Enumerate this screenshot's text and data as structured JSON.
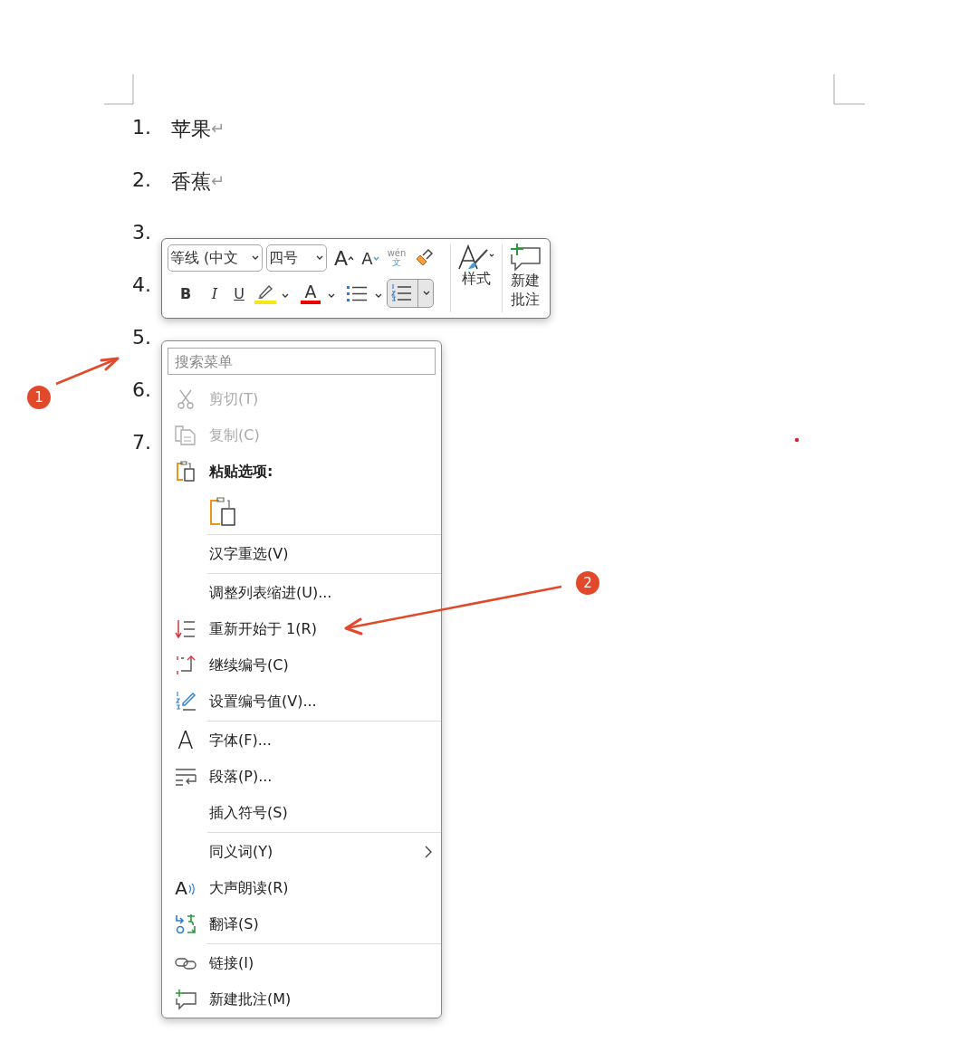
{
  "document": {
    "list": [
      {
        "number": "1.",
        "text": "苹果",
        "mark": "↵"
      },
      {
        "number": "2.",
        "text": "香蕉",
        "mark": "↵"
      },
      {
        "number": "3."
      },
      {
        "number": "4."
      },
      {
        "number": "5."
      },
      {
        "number": "6."
      },
      {
        "number": "7."
      }
    ]
  },
  "mini_toolbar": {
    "font": "等线 (中文",
    "size": "四号",
    "grow_font": "A",
    "shrink_font": "A",
    "phonetic": {
      "top": "wén",
      "bottom": "文"
    },
    "format_buttons": [
      {
        "kind": "bold",
        "glyph": "B",
        "selected": false
      },
      {
        "kind": "italic",
        "glyph": "I",
        "selected": false
      },
      {
        "kind": "underline",
        "glyph": "U",
        "selected": false
      },
      {
        "kind": "highlight",
        "selected": false
      },
      {
        "kind": "font-color",
        "glyph": "A",
        "selected": false
      },
      {
        "kind": "bullets",
        "selected": false
      },
      {
        "kind": "numbering",
        "selected": true
      }
    ],
    "styles": "样式",
    "new_comment": "新建批注"
  },
  "context_menu": {
    "items": [
      {
        "kind": "search",
        "placeholder": "搜索菜单"
      },
      {
        "kind": "item",
        "label": "剪切(T)",
        "disabled": true,
        "submenu": false
      },
      {
        "kind": "item",
        "label": "复制(C)",
        "disabled": true,
        "submenu": false
      },
      {
        "kind": "header",
        "label": "粘贴选项:"
      },
      {
        "kind": "paste-options"
      },
      {
        "kind": "separator"
      },
      {
        "kind": "item",
        "label": "汉字重选(V)",
        "disabled": false,
        "submenu": false
      },
      {
        "kind": "separator"
      },
      {
        "kind": "item",
        "label": "调整列表缩进(U)...",
        "disabled": false,
        "submenu": false
      },
      {
        "kind": "item",
        "label": "重新开始于 1(R)",
        "disabled": false,
        "submenu": false
      },
      {
        "kind": "item",
        "label": "继续编号(C)",
        "disabled": false,
        "submenu": false
      },
      {
        "kind": "item",
        "label": "设置编号值(V)...",
        "disabled": false,
        "submenu": false
      },
      {
        "kind": "separator"
      },
      {
        "kind": "item",
        "label": "字体(F)...",
        "disabled": false,
        "submenu": false,
        "icon_glyph": "A"
      },
      {
        "kind": "item",
        "label": "段落(P)...",
        "disabled": false,
        "submenu": false
      },
      {
        "kind": "item",
        "label": "插入符号(S)",
        "disabled": false,
        "submenu": false
      },
      {
        "kind": "separator"
      },
      {
        "kind": "item",
        "label": "同义词(Y)",
        "disabled": false,
        "submenu": true
      },
      {
        "kind": "item",
        "label": "大声朗读(R)",
        "disabled": false,
        "submenu": false,
        "icon_glyph": "A"
      },
      {
        "kind": "item",
        "label": "翻译(S)",
        "disabled": false,
        "submenu": false
      },
      {
        "kind": "separator"
      },
      {
        "kind": "item",
        "label": "链接(I)",
        "disabled": false,
        "submenu": false
      },
      {
        "kind": "item",
        "label": "新建批注(M)",
        "disabled": false,
        "submenu": false
      }
    ]
  },
  "annotations": [
    {
      "label": "1"
    },
    {
      "label": "2"
    }
  ]
}
